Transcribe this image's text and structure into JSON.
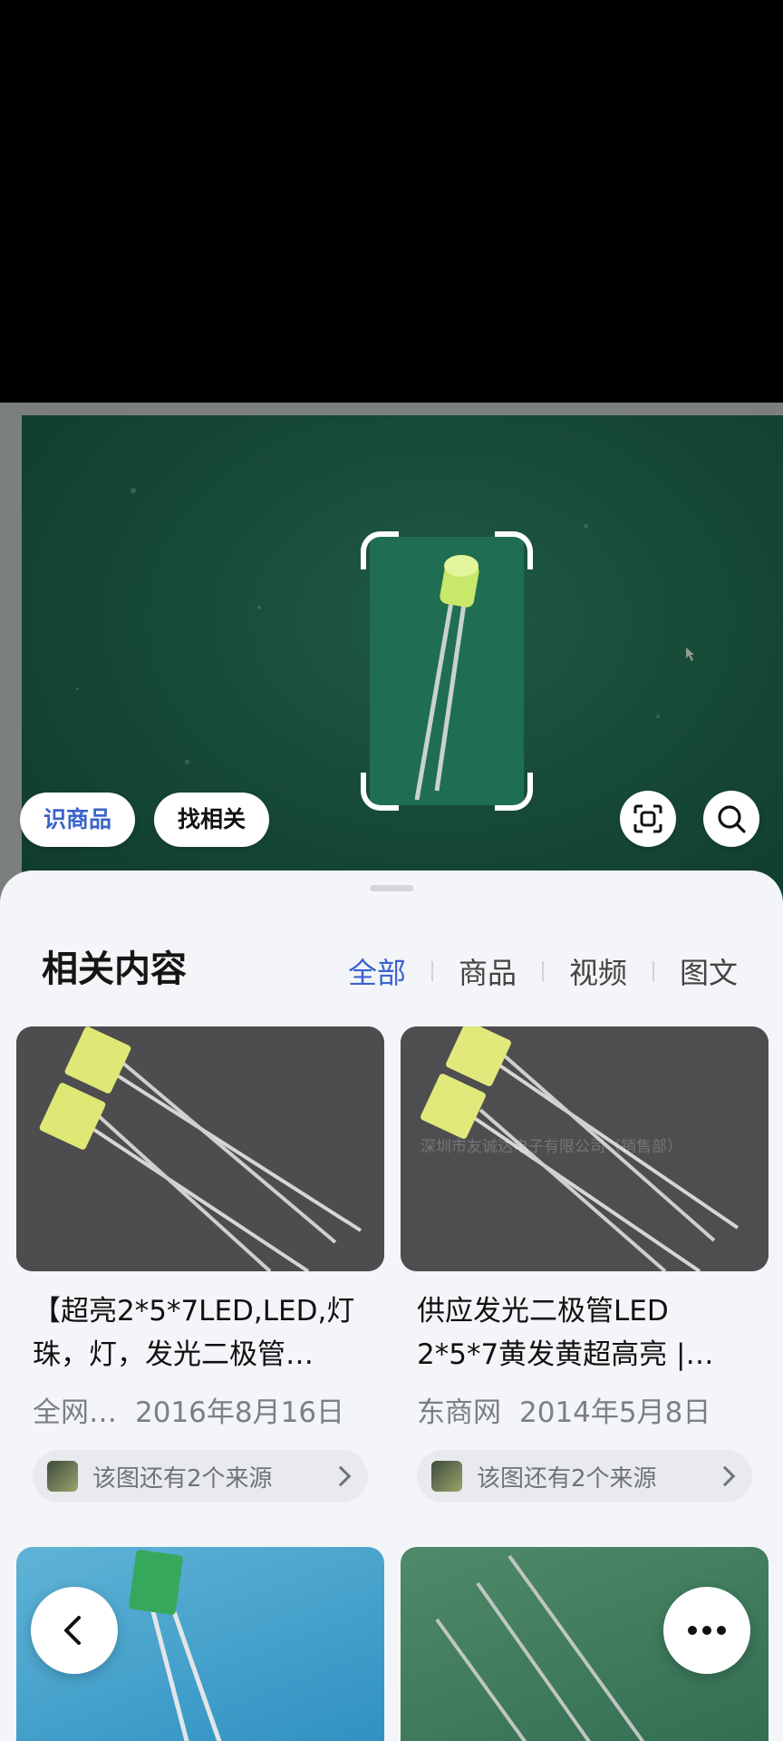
{
  "image_actions": {
    "identify_product_label": "识商品",
    "find_related_label": "找相关"
  },
  "sheet": {
    "title": "相关内容",
    "tabs": [
      {
        "label": "全部",
        "active": true
      },
      {
        "label": "商品",
        "active": false
      },
      {
        "label": "视频",
        "active": false
      },
      {
        "label": "图文",
        "active": false
      }
    ]
  },
  "results": [
    {
      "title": "【超亮2*5*7LED,LED,灯珠，灯，发光二极管…",
      "source_name": "全网…",
      "date": "2016年8月16日",
      "more_sources": "该图还有2个来源"
    },
    {
      "title": "供应发光二极管LED 2*5*7黄发黄超高亮 |…",
      "source_name": "东商网",
      "date": "2014年5月8日",
      "more_sources": "该图还有2个来源",
      "watermark": "深圳市友诚达电子有限公司（销售部）"
    }
  ],
  "colors": {
    "accent": "#3a63cf",
    "sheet_bg": "#f4f5f8",
    "board_green": "#174a37"
  },
  "icons": {
    "scan": "scan-frame-icon",
    "search": "search-icon",
    "back": "chevron-left-icon",
    "more": "more-dots-icon"
  }
}
